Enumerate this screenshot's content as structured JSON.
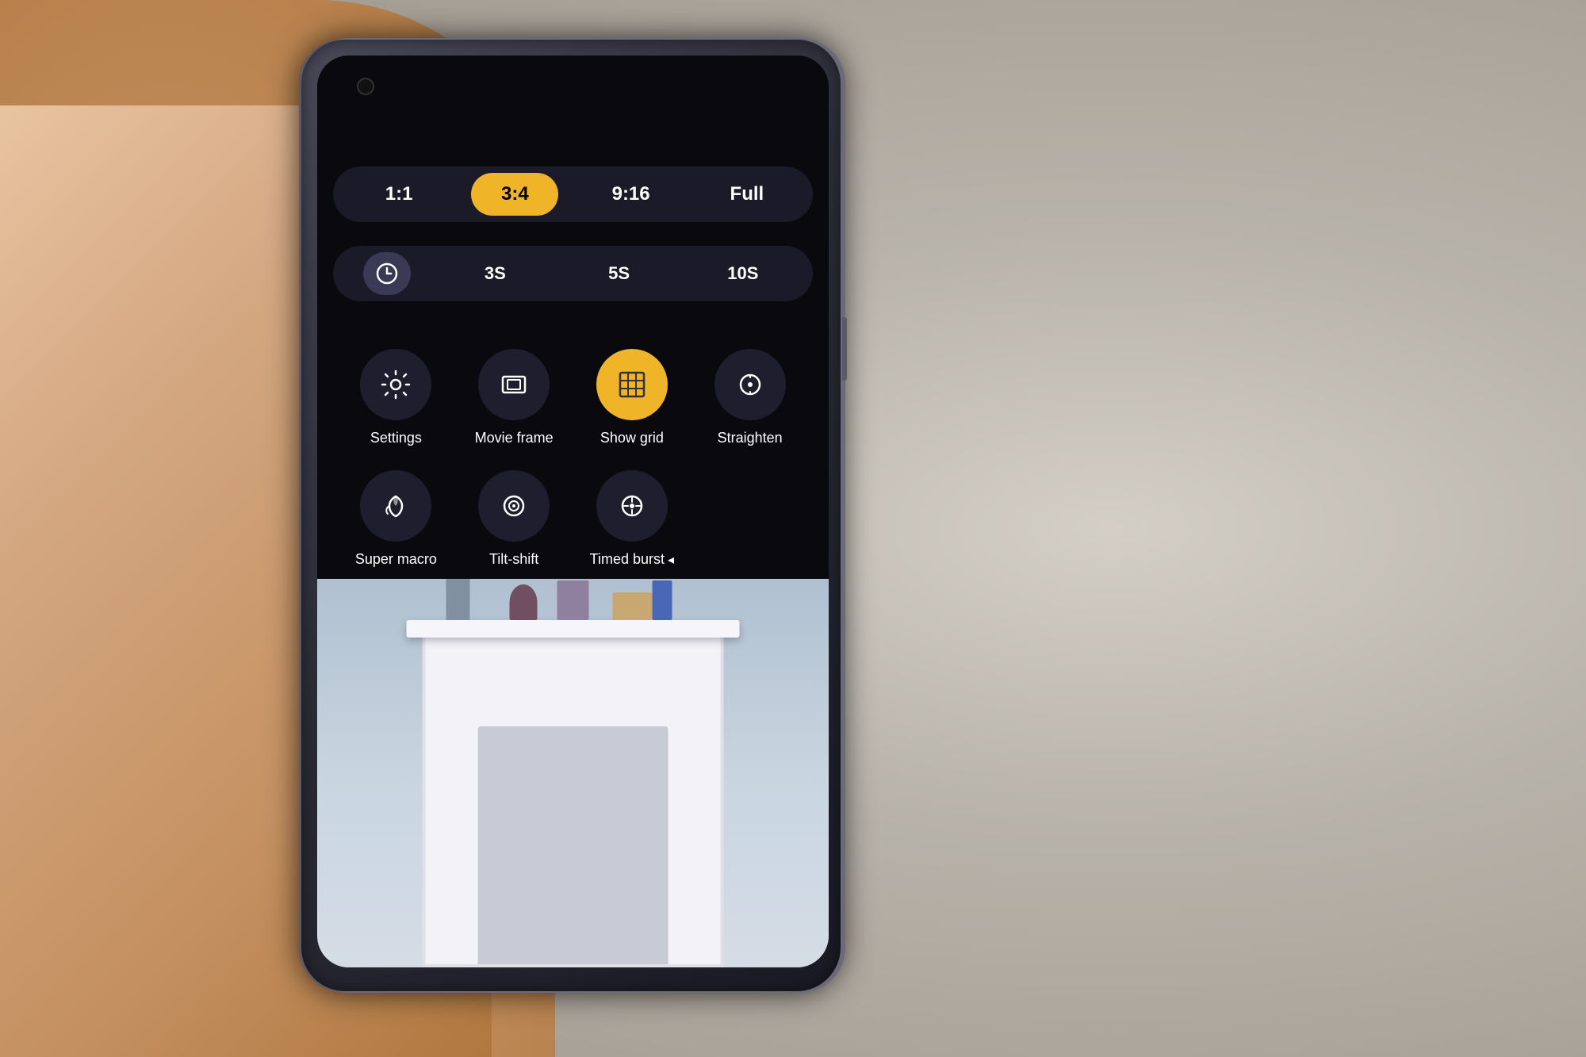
{
  "background": {
    "color": "#c0bbb2"
  },
  "phone": {
    "screen_bg": "#000000"
  },
  "aspect_ratio": {
    "options": [
      {
        "label": "1:1",
        "active": false,
        "id": "ratio-1-1"
      },
      {
        "label": "3:4",
        "active": true,
        "id": "ratio-3-4"
      },
      {
        "label": "9:16",
        "active": false,
        "id": "ratio-9-16"
      },
      {
        "label": "Full",
        "active": false,
        "id": "ratio-full"
      }
    ]
  },
  "timer": {
    "options": [
      {
        "label": "⏱",
        "active": true,
        "id": "timer-off",
        "is_icon": true
      },
      {
        "label": "3S",
        "active": false,
        "id": "timer-3s"
      },
      {
        "label": "5S",
        "active": false,
        "id": "timer-5s"
      },
      {
        "label": "10S",
        "active": false,
        "id": "timer-10s"
      }
    ]
  },
  "icons": [
    {
      "id": "settings",
      "label": "Settings",
      "active": false,
      "icon": "gear"
    },
    {
      "id": "movie-frame",
      "label": "Movie frame",
      "active": false,
      "icon": "movie"
    },
    {
      "id": "show-grid",
      "label": "Show grid",
      "active": true,
      "icon": "grid"
    },
    {
      "id": "straighten",
      "label": "Straighten",
      "active": false,
      "icon": "straighten"
    },
    {
      "id": "super-macro",
      "label": "Super macro",
      "active": false,
      "icon": "macro"
    },
    {
      "id": "tilt-shift",
      "label": "Tilt-shift",
      "active": false,
      "icon": "tiltshift"
    },
    {
      "id": "timed-burst",
      "label": "Timed burst",
      "active": false,
      "icon": "timedburst"
    }
  ],
  "timed_burst_indicator": "◂"
}
